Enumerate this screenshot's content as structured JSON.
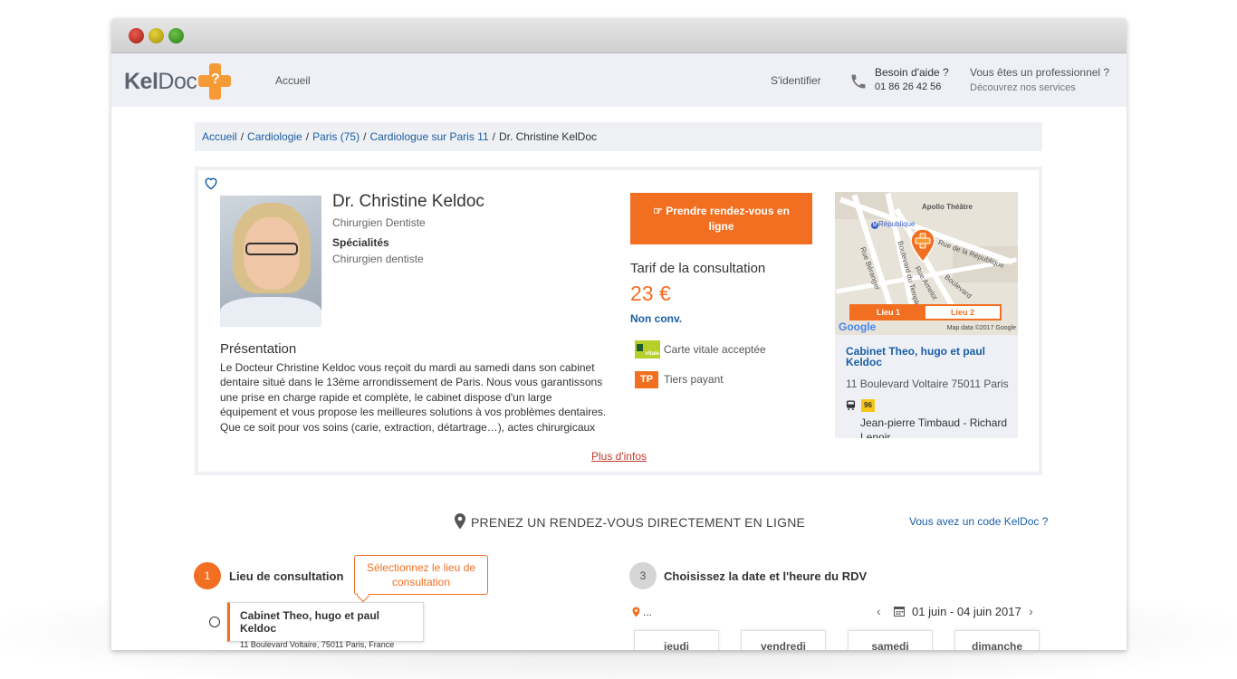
{
  "window": {
    "controls": [
      "close",
      "minimize",
      "maximize"
    ]
  },
  "navbar": {
    "logo_part1": "Kel",
    "logo_part2": "Doc",
    "logo_glyph": "?",
    "home": "Accueil",
    "login": "S'identifier",
    "help_title": "Besoin d'aide ?",
    "help_phone": "01 86 26 42 56",
    "pro_title": "Vous êtes un professionnel ?",
    "pro_link": "Découvrez nos services"
  },
  "breadcrumb": {
    "items": [
      "Accueil",
      "Cardiologie",
      "Paris (75)",
      "Cardiologue sur Paris 11"
    ],
    "separator": "/",
    "current": "Dr. Christine KelDoc"
  },
  "doctor": {
    "name": "Dr. Christine Keldoc",
    "title": "Chirurgien Dentiste",
    "specialties_label": "Spécialités",
    "specialty": "Chirurgien dentiste",
    "presentation_title": "Présentation",
    "presentation_text": "Le Docteur Christine Keldoc vous reçoit du mardi au samedi dans son cabinet dentaire situé dans le 13ème arrondissement de Paris. Nous vous garantissons une prise en charge rapide et complète, le cabinet dispose d'un large équipement et vous propose les meilleures solutions à vos problèmes dentaires. Que ce soit pour vos soins (carie, extraction, détartrage…), actes chirurgicaux (implants,",
    "more_link": "Plus d'infos"
  },
  "booking": {
    "button_label": "Prendre rendez-vous en ligne",
    "button_icon": "hand-pointer-icon",
    "tarif_title": "Tarif de la consultation",
    "price": "23 €",
    "convention": "Non conv.",
    "vitale_badge": "vitale",
    "vitale_label": "Carte vitale acceptée",
    "tp_badge": "TP",
    "tp_label": "Tiers payant"
  },
  "map": {
    "labels": [
      "Apollo Théâtre",
      "République",
      "Rue de la République",
      "Rue Béranger",
      "Boulevard du Temple",
      "Rue Amelot",
      "Boulevard"
    ],
    "tabs": [
      "Lieu 1",
      "Lieu 2"
    ],
    "active_tab": "Lieu 1",
    "google": "Google",
    "attribution": "Map data ©2017 Google",
    "metro_badge": "M"
  },
  "place": {
    "name": "Cabinet Theo, hugo et paul Keldoc",
    "address": "11 Boulevard Voltaire 75011 Paris",
    "bus_line": "96",
    "bus_stop": "Jean-pierre Timbaud - Richard Lenoir"
  },
  "rdv_section": {
    "title": "PRENEZ UN RENDEZ-VOUS DIRECTEMENT EN LIGNE",
    "code_link": "Vous avez un code KelDoc ?"
  },
  "step1": {
    "number": "1",
    "title": "Lieu de consultation",
    "tooltip": "Sélectionnez le lieu de consultation",
    "option_name": "Cabinet Theo, hugo et paul Keldoc",
    "option_address": "11 Boulevard Voltaire, 75011 Paris, France"
  },
  "step3": {
    "number": "3",
    "title": "Choisissez la date et l'heure du RDV",
    "location_placeholder": "...",
    "prev": "‹",
    "next": "›",
    "date_range": "01 juin - 04 juin 2017",
    "days": [
      "jeudi",
      "vendredi",
      "samedi",
      "dimanche"
    ]
  },
  "colors": {
    "accent": "#f26f21",
    "link": "#1a5fa5",
    "navbar_bg": "#eef0f6"
  }
}
